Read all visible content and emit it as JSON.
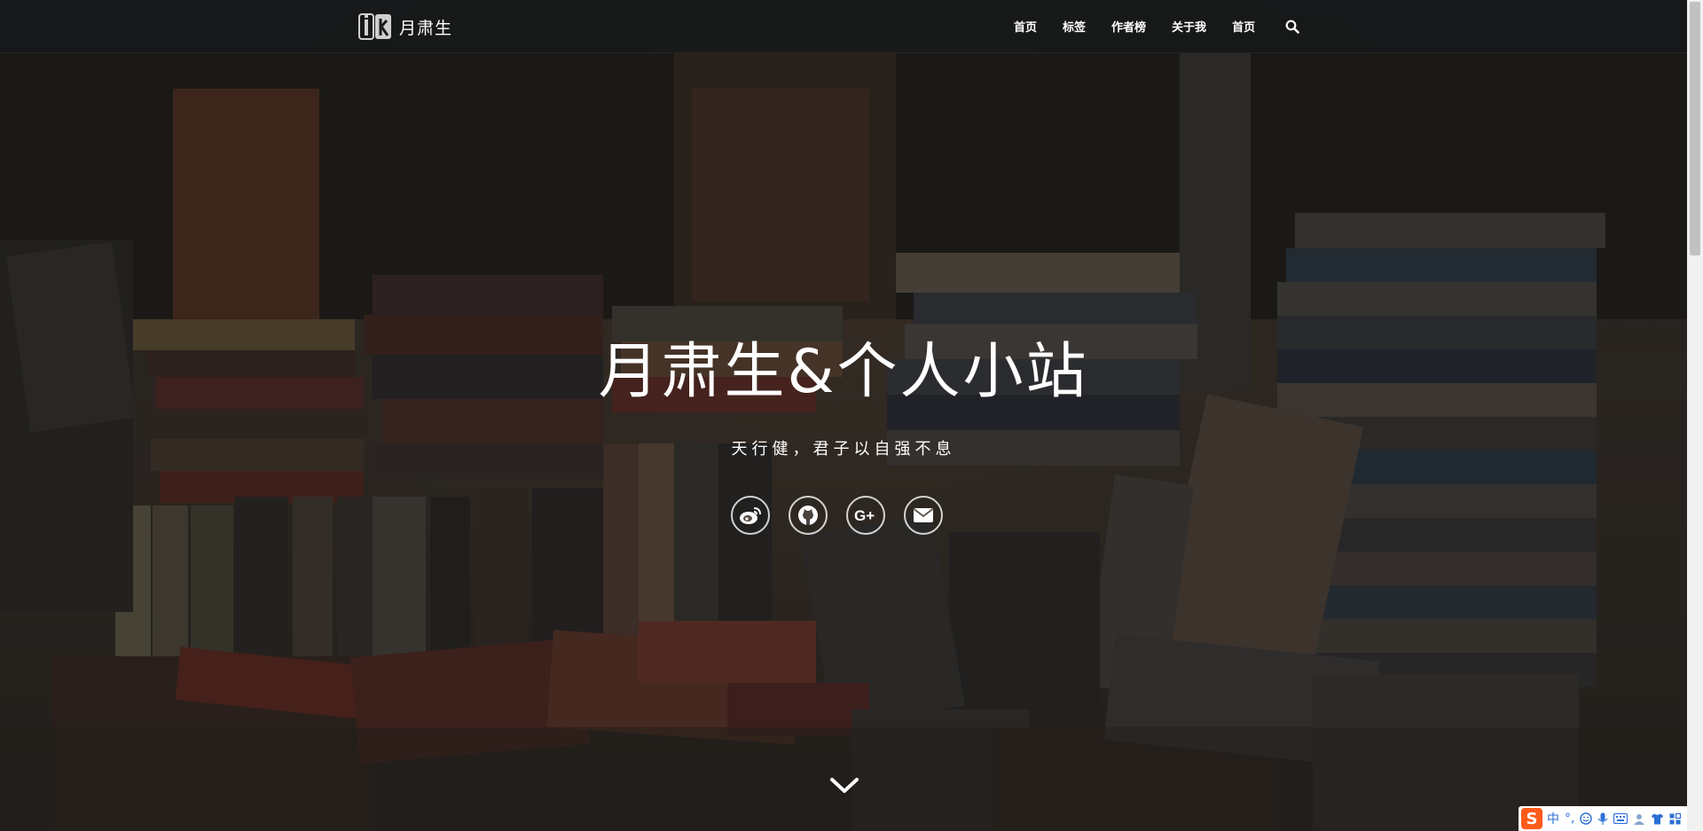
{
  "nav": {
    "brand_mark": "ik",
    "brand_name": "月肃生",
    "links": [
      "首页",
      "标签",
      "作者榜",
      "关于我",
      "首页"
    ]
  },
  "hero": {
    "title": "月肃生&个人小站",
    "subtitle": "天行健，君子以自强不息"
  },
  "social": [
    {
      "icon": "weibo-icon"
    },
    {
      "icon": "github-icon"
    },
    {
      "icon": "google-plus-icon"
    },
    {
      "icon": "email-icon"
    }
  ],
  "ime": {
    "mode": "中",
    "punct": "°,"
  },
  "colors": {
    "nav_bg": "#161819",
    "text": "#ffffff",
    "ime_logo": "#ff5b1a",
    "ime_accent": "#2b6fd6"
  }
}
